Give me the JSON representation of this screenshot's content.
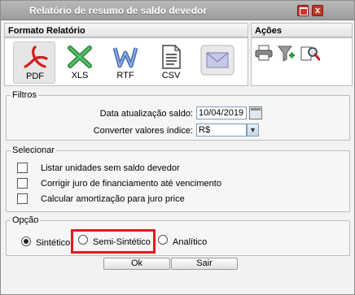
{
  "window": {
    "title": "Relatório de resumo de saldo devedor",
    "close_label": "x"
  },
  "formato": {
    "header": "Formato Relatório",
    "buttons": [
      {
        "label": "PDF",
        "icon": "pdf-icon",
        "selected": true
      },
      {
        "label": "XLS",
        "icon": "excel-icon",
        "selected": false
      },
      {
        "label": "RTF",
        "icon": "word-icon",
        "selected": false
      },
      {
        "label": "CSV",
        "icon": "csv-file-icon",
        "selected": false
      },
      {
        "label": "",
        "icon": "email-icon",
        "selected": false
      }
    ]
  },
  "acoes": {
    "header": "Ações",
    "icons": [
      "printer-icon",
      "filter-icon",
      "preview-magnifier-icon"
    ]
  },
  "filtros": {
    "legend": "Filtros",
    "data_label": "Data atualização saldo:",
    "data_value": "10/04/2019",
    "converter_label": "Converter valores índice:",
    "converter_value": "R$"
  },
  "selecionar": {
    "legend": "Selecionar",
    "items": [
      {
        "label": "Listar unidades sem saldo devedor",
        "checked": false
      },
      {
        "label": "Corrigir juro de financiamento até vencimento",
        "checked": false
      },
      {
        "label": "Calcular amortização para juro price",
        "checked": false
      }
    ]
  },
  "opcao": {
    "legend": "Opção",
    "options": [
      {
        "label": "Sintético",
        "selected": true
      },
      {
        "label": "Semi-Sintético",
        "selected": false
      },
      {
        "label": "Analítico",
        "selected": false
      }
    ]
  },
  "footer": {
    "ok_label": "Ok",
    "cancel_label": "Sair"
  },
  "colors": {
    "titlebar": "#a9a9a9",
    "window_button": "#c0392b",
    "highlight": "#e5181e"
  }
}
